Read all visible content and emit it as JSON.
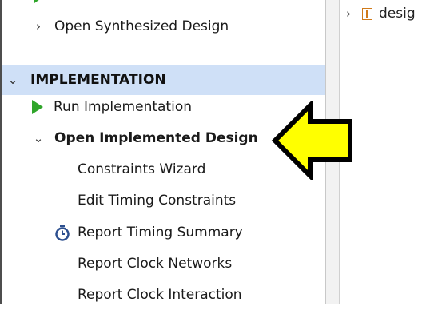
{
  "flow_navigator": {
    "synthesized": {
      "label": "Open Synthesized Design",
      "chevron": "chevron-right-icon"
    },
    "implementation_section": {
      "title": "IMPLEMENTATION",
      "chevron": "chevron-down-icon"
    },
    "run_implementation": {
      "label": "Run Implementation",
      "icon": "play-icon"
    },
    "implemented_design": {
      "label": "Open Implemented Design",
      "chevron": "chevron-down-icon"
    },
    "children": [
      {
        "label": "Constraints Wizard"
      },
      {
        "label": "Edit Timing Constraints"
      },
      {
        "label": "Report Timing Summary",
        "icon": "stopwatch-icon"
      },
      {
        "label": "Report Clock Networks"
      },
      {
        "label": "Report Clock Interaction"
      }
    ]
  },
  "sources_panel": {
    "tree_item": {
      "label": "desig",
      "icon": "design-file-icon"
    }
  },
  "colors": {
    "section_highlight": "#cfe0f7",
    "run_green": "#2fa52a",
    "callout_arrow_fill": "#ffff00",
    "stopwatch_blue": "#2c4f8f"
  }
}
